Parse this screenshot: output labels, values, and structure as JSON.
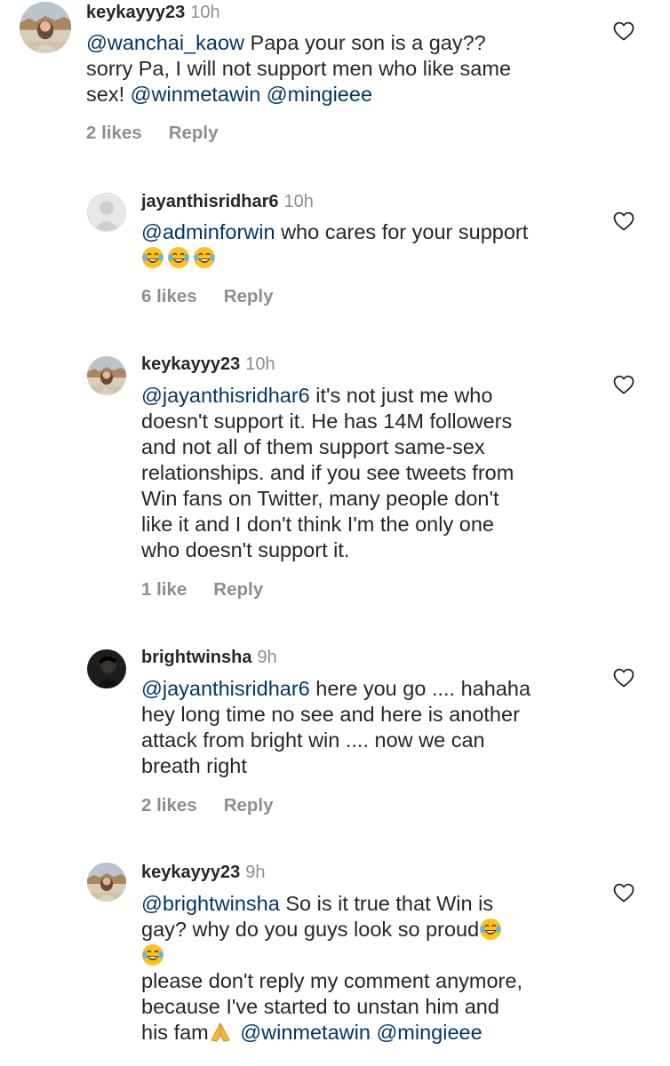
{
  "comments": [
    {
      "username": "keykayyy23",
      "time": "10h",
      "avatar": "profile-photo",
      "lines": [
        [
          {
            "t": "@wanchai_kaow",
            "m": true
          },
          {
            "t": " Papa your son is a gay??"
          }
        ],
        [
          {
            "t": "sorry Pa, I will not support men who like same"
          }
        ],
        [
          {
            "t": "sex! "
          },
          {
            "t": "@winmetawin",
            "m": true
          },
          {
            "t": " "
          },
          {
            "t": "@mingieee",
            "m": true
          }
        ]
      ],
      "likes": "2 likes",
      "reply": "Reply"
    },
    {
      "username": "jayanthisridhar6",
      "time": "10h",
      "avatar": "default-avatar",
      "lines": [
        [
          {
            "t": "@adminforwin",
            "m": true
          },
          {
            "t": " who cares for your support"
          }
        ],
        [
          {
            "e": "laughing-tears"
          },
          {
            "e": "laughing-tears"
          },
          {
            "e": "laughing-tears"
          }
        ]
      ],
      "likes": "6 likes",
      "reply": "Reply"
    },
    {
      "username": "keykayyy23",
      "time": "10h",
      "avatar": "profile-photo",
      "lines": [
        [
          {
            "t": "@jayanthisridhar6",
            "m": true
          },
          {
            "t": " it's not just me who"
          }
        ],
        [
          {
            "t": "doesn't support it. He has 14M followers"
          }
        ],
        [
          {
            "t": "and not all of them support same-sex"
          }
        ],
        [
          {
            "t": "relationships. and if you see tweets from"
          }
        ],
        [
          {
            "t": "Win fans on Twitter, many people don't"
          }
        ],
        [
          {
            "t": "like it and I don't think I'm the only one"
          }
        ],
        [
          {
            "t": "who doesn't support it."
          }
        ]
      ],
      "likes": "1 like",
      "reply": "Reply"
    },
    {
      "username": "brightwinsha",
      "time": "9h",
      "avatar": "profile-photo-dark",
      "lines": [
        [
          {
            "t": "@jayanthisridhar6",
            "m": true
          },
          {
            "t": " here you go .... hahaha"
          }
        ],
        [
          {
            "t": "hey long time no see and here is another"
          }
        ],
        [
          {
            "t": "attack from bright win .... now we can"
          }
        ],
        [
          {
            "t": "breath right"
          }
        ]
      ],
      "likes": "2 likes",
      "reply": "Reply"
    },
    {
      "username": "keykayyy23",
      "time": "9h",
      "avatar": "profile-photo",
      "lines": [
        [
          {
            "t": "@brightwinsha",
            "m": true
          },
          {
            "t": " So is it true that Win is"
          }
        ],
        [
          {
            "t": "gay? why do you guys look so proud"
          },
          {
            "e": "laughing-tears"
          }
        ],
        [
          {
            "e": "laughing-tears"
          }
        ],
        [
          {
            "t": "please don't reply my comment anymore,"
          }
        ],
        [
          {
            "t": "because I've started to unstan him and"
          }
        ],
        [
          {
            "t": "his fam"
          },
          {
            "e": "folded-hands"
          },
          {
            "t": "  "
          },
          {
            "t": "@winmetawin",
            "m": true
          },
          {
            "t": " "
          },
          {
            "t": "@mingieee",
            "m": true
          }
        ]
      ],
      "likes": null,
      "reply": null
    }
  ],
  "colors": {
    "text": "#262626",
    "muted": "#8e8e8e",
    "mention": "#00376b",
    "heart": "#262626"
  }
}
